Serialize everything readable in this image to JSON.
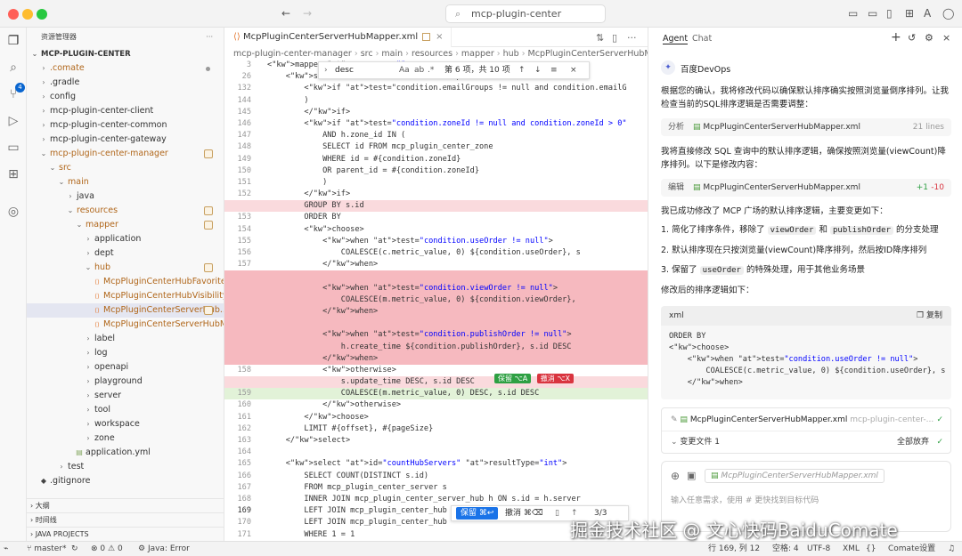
{
  "window": {
    "search": "mcp-plugin-center"
  },
  "explorer": {
    "title": "资源管理器",
    "root": "MCP-PLUGIN-CENTER",
    "items": [
      ".comate",
      ".gradle",
      "config",
      "mcp-plugin-center-client",
      "mcp-plugin-center-common",
      "mcp-plugin-center-gateway",
      "mcp-plugin-center-manager",
      "src",
      "main",
      "java",
      "resources",
      "mapper",
      "application",
      "dept",
      "hub",
      "McpPluginCenterHubFavoriteMap...",
      "McpPluginCenterHubVisibilityMap...",
      "McpPluginCenterServerHub...",
      "McpPluginCenterServerHubMetri...",
      "label",
      "log",
      "openapi",
      "playground",
      "server",
      "tool",
      "workspace",
      "zone",
      "application.yml",
      "test",
      ".gitignore"
    ],
    "sections": [
      "大纲",
      "时间线",
      "JAVA PROJECTS"
    ]
  },
  "activity": {
    "badge": "4"
  },
  "editor": {
    "tab": "McpPluginCenterServerHubMapper.xml",
    "breadcrumb": [
      "mcp-plugin-center-manager",
      "src",
      "main",
      "resources",
      "mapper",
      "hub",
      "McpPluginCenterServerHubMa"
    ],
    "find": {
      "query": "desc",
      "aa": "Aa",
      "count": "第 6 项，共 10 项"
    },
    "lines": [
      {
        "n": "3",
        "t": "<mapper namespace=\"\">"
      },
      {
        "n": "26",
        "t": "    <select id=\"\" resultMap=\"\">"
      },
      {
        "n": "132",
        "t": "        <if test=\"condition.emailGroups != null and condition.emailG"
      },
      {
        "n": "144",
        "t": "        )"
      },
      {
        "n": "145",
        "t": "        </if>"
      },
      {
        "n": "146",
        "t": "        <if test=\"condition.zoneId != null and condition.zoneId > 0\""
      },
      {
        "n": "147",
        "t": "            AND h.zone_id IN ("
      },
      {
        "n": "148",
        "t": "            SELECT id FROM mcp_plugin_center_zone"
      },
      {
        "n": "149",
        "t": "            WHERE id = #{condition.zoneId}"
      },
      {
        "n": "150",
        "t": "            OR parent_id = #{condition.zoneId}"
      },
      {
        "n": "151",
        "t": "            )"
      },
      {
        "n": "152",
        "t": "        </if>"
      },
      {
        "n": "",
        "t": "        GROUP BY s.id"
      },
      {
        "n": "153",
        "t": "        ORDER BY"
      },
      {
        "n": "154",
        "t": "        <choose>"
      },
      {
        "n": "155",
        "t": "            <when test=\"condition.useOrder != null\">"
      },
      {
        "n": "156",
        "t": "                COALESCE(c.metric_value, 0) ${condition.useOrder}, s"
      },
      {
        "n": "157",
        "t": "            </when>"
      },
      {
        "n": "",
        "t": ""
      },
      {
        "n": "",
        "t": "            <when test=\"condition.viewOrder != null\">"
      },
      {
        "n": "",
        "t": "                COALESCE(m.metric_value, 0) ${condition.viewOrder},"
      },
      {
        "n": "",
        "t": "            </when>"
      },
      {
        "n": "",
        "t": ""
      },
      {
        "n": "",
        "t": "            <when test=\"condition.publishOrder != null\">"
      },
      {
        "n": "",
        "t": "                h.create_time ${condition.publishOrder}, s.id DESC"
      },
      {
        "n": "",
        "t": "            </when>"
      },
      {
        "n": "158",
        "t": "            <otherwise>"
      },
      {
        "n": "",
        "t": "                s.update_time DESC, s.id DESC"
      },
      {
        "n": "159",
        "t": "                COALESCE(m.metric_value, 0) DESC, s.id DESC"
      },
      {
        "n": "160",
        "t": "            </otherwise>"
      },
      {
        "n": "161",
        "t": "        </choose>"
      },
      {
        "n": "162",
        "t": "        LIMIT #{offset}, #{pageSize}"
      },
      {
        "n": "163",
        "t": "    </select>"
      },
      {
        "n": "164",
        "t": ""
      },
      {
        "n": "165",
        "t": "    <select id=\"countHubServers\" resultType=\"int\">"
      },
      {
        "n": "166",
        "t": "        SELECT COUNT(DISTINCT s.id)"
      },
      {
        "n": "167",
        "t": "        FROM mcp_plugin_center_server s"
      },
      {
        "n": "168",
        "t": "        INNER JOIN mcp_plugin_center_server_hub h ON s.id = h.server"
      },
      {
        "n": "169",
        "t": "        LEFT JOIN mcp_plugin_center_hub"
      },
      {
        "n": "170",
        "t": "        LEFT JOIN mcp_plugin_center_hub"
      },
      {
        "n": "171",
        "t": "        WHERE 1 = 1"
      }
    ],
    "inline": {
      "keep": "保留 ⌥A",
      "undo": "撤消 ⌥X"
    },
    "bottom": {
      "keep": "保留 ⌘↩",
      "undo": "撤消 ⌘⌫",
      "page": "3/3"
    }
  },
  "chat": {
    "tabs": [
      "Agent",
      "Chat"
    ],
    "bot": "百度DevOps",
    "p1": "根据您的确认，我将修改代码以确保默认排序确实按照浏览量倒序排列。让我检查当前的SQL排序逻辑是否需要调整：",
    "analysis": {
      "tag": "分析",
      "file": "McpPluginCenterServerHubMapper.xml",
      "meta": "21 lines"
    },
    "p2": "我将直接修改 SQL 查询中的默认排序逻辑，确保按照浏览量(viewCount)降序排列。以下是修改内容：",
    "edit": {
      "tag": "编辑",
      "file": "McpPluginCenterServerHubMapper.xml",
      "plus": "+1",
      "minus": "-10"
    },
    "p3": "我已成功修改了 MCP 广场的默认排序逻辑，主要变更如下：",
    "li1a": "1. 简化了排序条件，移除了",
    "li1b": "viewOrder",
    "li1c": "和",
    "li1d": "publishOrder",
    "li1e": "的分支处理",
    "li2": "2. 默认排序现在只按浏览量(viewCount)降序排列，然后按ID降序排列",
    "li3a": "3. 保留了",
    "li3b": "useOrder",
    "li3c": "的特殊处理，用于其他业务场景",
    "p4": "修改后的排序逻辑如下：",
    "code": {
      "lang": "xml",
      "copy": "复制",
      "lines": [
        "ORDER BY",
        "<choose>",
        "    <when test=\"condition.useOrder != null\">",
        "        COALESCE(c.metric_value, 0) ${condition.useOrder}, s",
        "    </when>"
      ]
    },
    "card": {
      "file": "McpPluginCenterServerHubMapper.xml",
      "path": "mcp-plugin-center-...",
      "changes": "变更文件 1",
      "discard": "全部放弃"
    },
    "input": {
      "chip": "McpPluginCenterServerHubMapper.xml",
      "placeholder": "输入任意需求，使用 # 更快找到目标代码"
    }
  },
  "status": {
    "branch": "master*",
    "errors": "0",
    "warnings": "0",
    "java": "Java: Error",
    "pos": "行 169, 列 12",
    "spaces": "空格: 4",
    "enc": "UTF-8",
    "lang": "XML",
    "comate": "Comate设置"
  },
  "watermark": "掘金技术社区 @ 文心快码BaiduComate"
}
